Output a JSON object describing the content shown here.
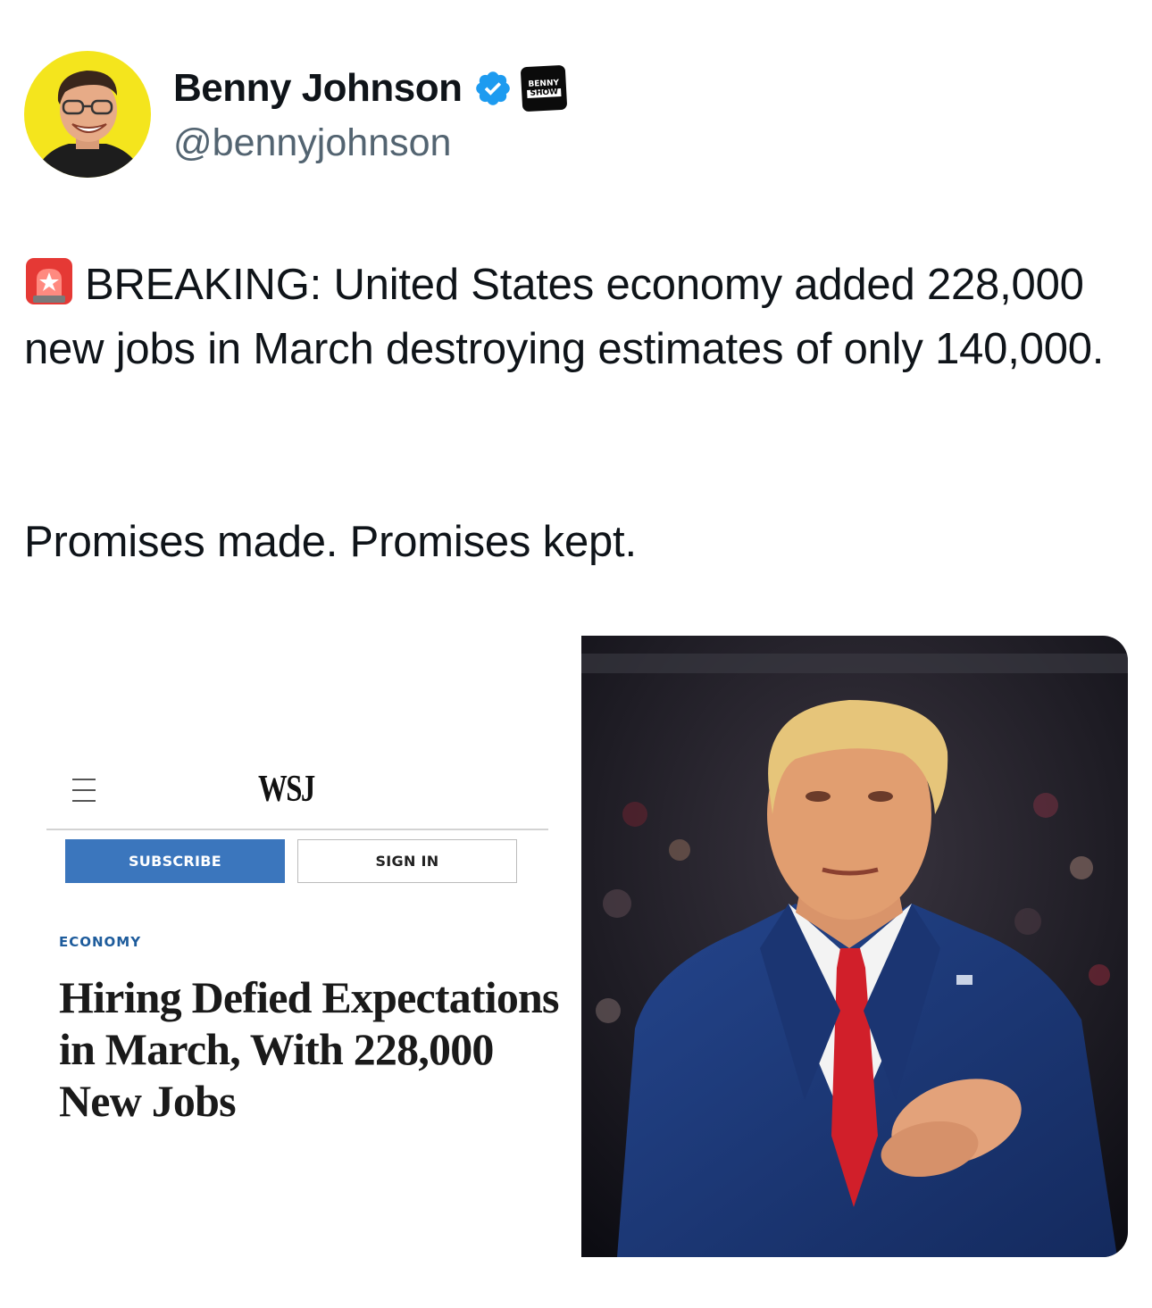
{
  "author": {
    "display_name": "Benny Johnson",
    "handle": "@bennyjohnson",
    "verified": true,
    "affiliate_badge": {
      "line1": "BENNY",
      "line2": "SHOW"
    },
    "avatar_bg": "#f5e61e"
  },
  "tweet": {
    "emoji": "🚨",
    "text": "BREAKING: United States economy added 228,000 new jobs in March destroying estimates of only 140,000.",
    "text2": "Promises made. Promises kept."
  },
  "media": {
    "wsj": {
      "logo": "WSJ",
      "subscribe_label": "SUBSCRIBE",
      "signin_label": "SIGN IN",
      "section": "ECONOMY",
      "headline": "Hiring Defied Expectations in March, With 228,000 New Jobs",
      "accent": "#3b76bd"
    }
  },
  "colors": {
    "text": "#0f1419",
    "secondary": "#536471",
    "verified": "#1d9bf0"
  }
}
